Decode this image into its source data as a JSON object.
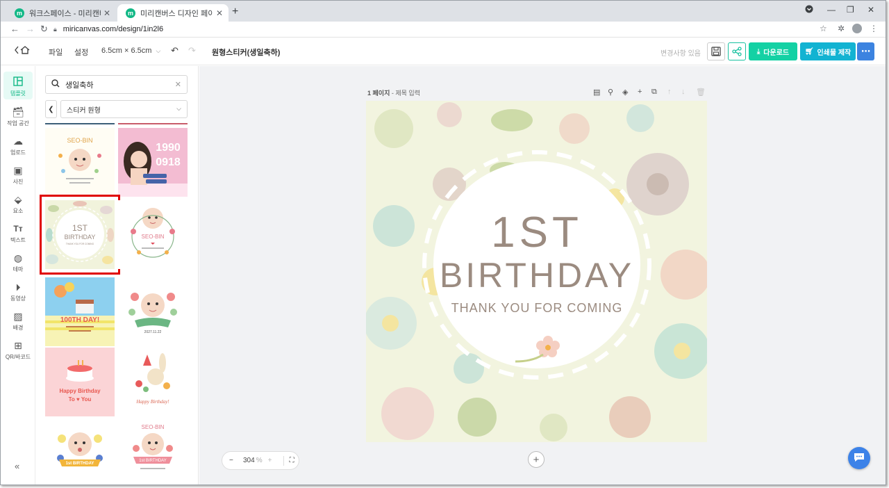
{
  "browser": {
    "tabs": [
      {
        "label": "워크스페이스 - 미리캔버스",
        "active": false
      },
      {
        "label": "미리캔버스 디자인 페이지",
        "active": true
      }
    ],
    "url": "miricanvas.com/design/1in2l6"
  },
  "header": {
    "menu_file": "파일",
    "menu_settings": "설정",
    "size": "6.5cm × 6.5cm",
    "doc_title": "원형스티커(생일축하)",
    "saved_status": "변경사항 있음",
    "download_label": "다운로드",
    "print_label": "인쇄물 제작"
  },
  "rail": {
    "items": [
      {
        "label": "템플릿",
        "icon": "template-icon",
        "active": true
      },
      {
        "label": "작업 공간",
        "icon": "workspace-icon"
      },
      {
        "label": "업로드",
        "icon": "upload-icon"
      },
      {
        "label": "사진",
        "icon": "photo-icon"
      },
      {
        "label": "요소",
        "icon": "elements-icon"
      },
      {
        "label": "텍스트",
        "icon": "text-icon"
      },
      {
        "label": "테마",
        "icon": "palette-icon"
      },
      {
        "label": "동영상",
        "icon": "video-icon"
      },
      {
        "label": "배경",
        "icon": "background-icon"
      },
      {
        "label": "QR/바코드",
        "icon": "qr-icon"
      }
    ]
  },
  "panel": {
    "search_value": "생일축하",
    "category": "스티커 원형",
    "templates": [
      {
        "id": "seo-bin-1",
        "texts": [
          "SEO-BIN"
        ]
      },
      {
        "id": "photo-1990",
        "texts": [
          "1990",
          "0918"
        ]
      },
      {
        "id": "first-birthday",
        "texts": [
          "1ST",
          "BIRTHDAY",
          "THANK YOU FOR COMING"
        ],
        "selected": true
      },
      {
        "id": "seo-bin-2",
        "texts": [
          "SEO-BIN"
        ]
      },
      {
        "id": "100th-day",
        "texts": [
          "100TH DAY!"
        ]
      },
      {
        "id": "baby-wreath",
        "texts": [
          "2027.11.22"
        ]
      },
      {
        "id": "happy-birthday-cake",
        "texts": [
          "Happy Birthday",
          "To ♥ You"
        ]
      },
      {
        "id": "bunny",
        "texts": [
          "Happy Birthday!"
        ]
      },
      {
        "id": "baby-1st",
        "texts": [
          "1st BIRTHDAY"
        ]
      },
      {
        "id": "seo-bin-3",
        "texts": [
          "SEO-BIN",
          "1st BIRTHDAY"
        ]
      }
    ]
  },
  "canvas": {
    "page_number": "1 페이지",
    "page_title_placeholder": "제목 입력",
    "design": {
      "line1": "1ST",
      "line2": "BIRTHDAY",
      "line3": "THANK YOU FOR COMING"
    },
    "zoom": "304",
    "zoom_unit": "%"
  },
  "colors": {
    "brand_green": "#14d1a4",
    "print_blue": "#12b3d2",
    "more_blue": "#3c83e0",
    "selection_red": "#e00000",
    "canvas_bg": "#f2f4df",
    "text_brown": "#9b8b80"
  }
}
